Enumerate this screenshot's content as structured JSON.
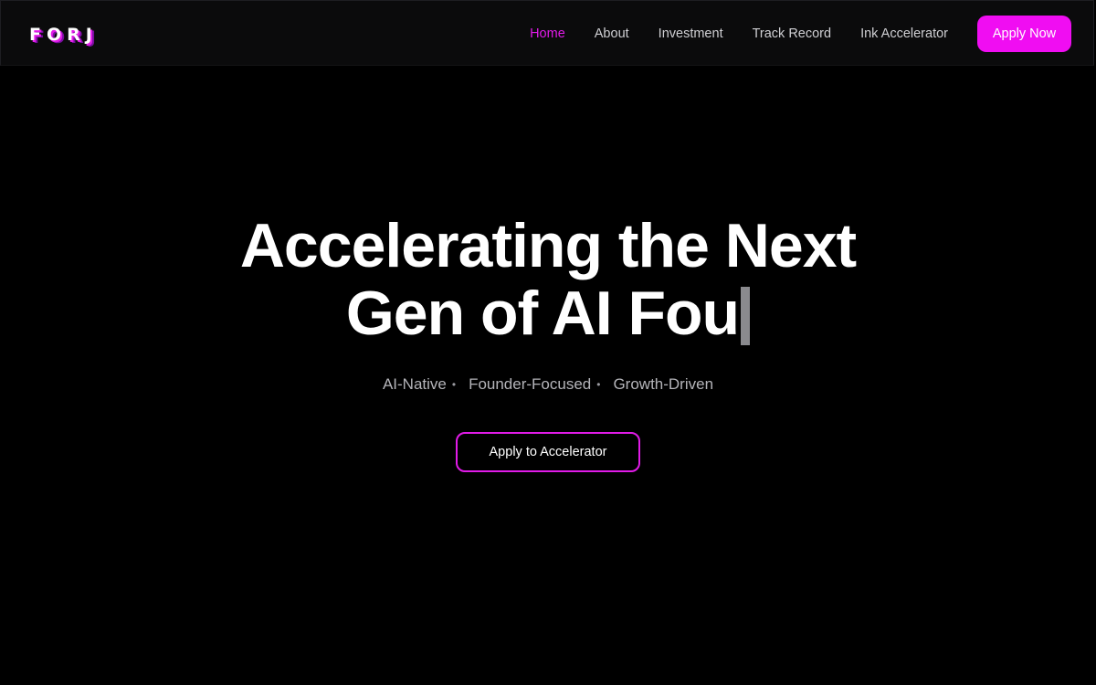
{
  "header": {
    "logo_letters": [
      "F",
      "O",
      "R",
      "J"
    ],
    "nav": [
      {
        "label": "Home",
        "active": true
      },
      {
        "label": "About",
        "active": false
      },
      {
        "label": "Investment",
        "active": false
      },
      {
        "label": "Track Record",
        "active": false
      },
      {
        "label": "Ink Accelerator",
        "active": false
      }
    ],
    "apply_label": "Apply Now"
  },
  "hero": {
    "title_line1": "Accelerating the Next",
    "title_line2": "Gen of AI Fou",
    "tags": [
      "AI-Native",
      "Founder-Focused",
      "Growth-Driven"
    ],
    "separator": "•",
    "cta_label": "Apply to Accelerator"
  },
  "colors": {
    "accent": "#e11be8",
    "button_bg": "#f00df2",
    "background": "#000000",
    "header_bg": "#0b0b0c"
  }
}
